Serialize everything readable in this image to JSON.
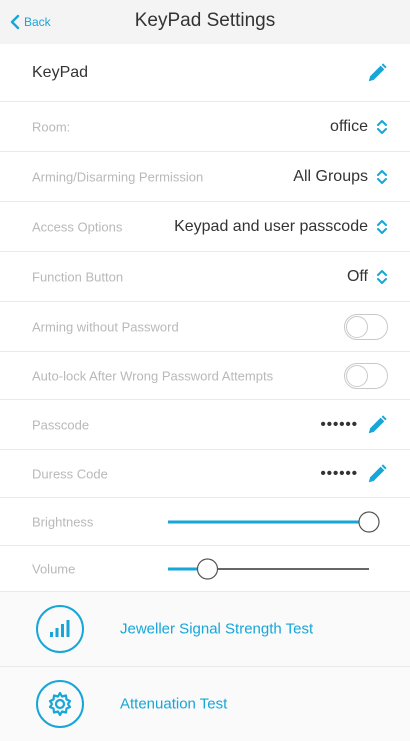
{
  "nav": {
    "back_label": "Back",
    "title": "KeyPad Settings"
  },
  "device": {
    "name": "KeyPad"
  },
  "settings": {
    "room": {
      "label": "Room:",
      "value": "office"
    },
    "permission": {
      "label": "Arming/Disarming Permission",
      "value": "All Groups"
    },
    "access": {
      "label": "Access Options",
      "value": "Keypad and user passcode"
    },
    "function_button": {
      "label": "Function Button",
      "value": "Off"
    },
    "arming_without_password": {
      "label": "Arming without Password",
      "enabled": false
    },
    "auto_lock": {
      "label": "Auto-lock After Wrong Password Attempts",
      "enabled": false
    },
    "passcode": {
      "label": "Passcode",
      "value": "••••••"
    },
    "duress": {
      "label": "Duress Code",
      "value": "••••••"
    },
    "brightness": {
      "label": "Brightness",
      "level": 1.0
    },
    "volume": {
      "label": "Volume",
      "level": 0.15
    }
  },
  "tests": [
    {
      "label": "Jeweller Signal Strength Test",
      "icon": "signal-bars-icon"
    },
    {
      "label": "Attenuation Test",
      "icon": "gear-icon"
    }
  ],
  "colors": {
    "accent": "#16a6d8",
    "muted_text": "#b9b9b9",
    "divider": "#e9e9e9"
  }
}
